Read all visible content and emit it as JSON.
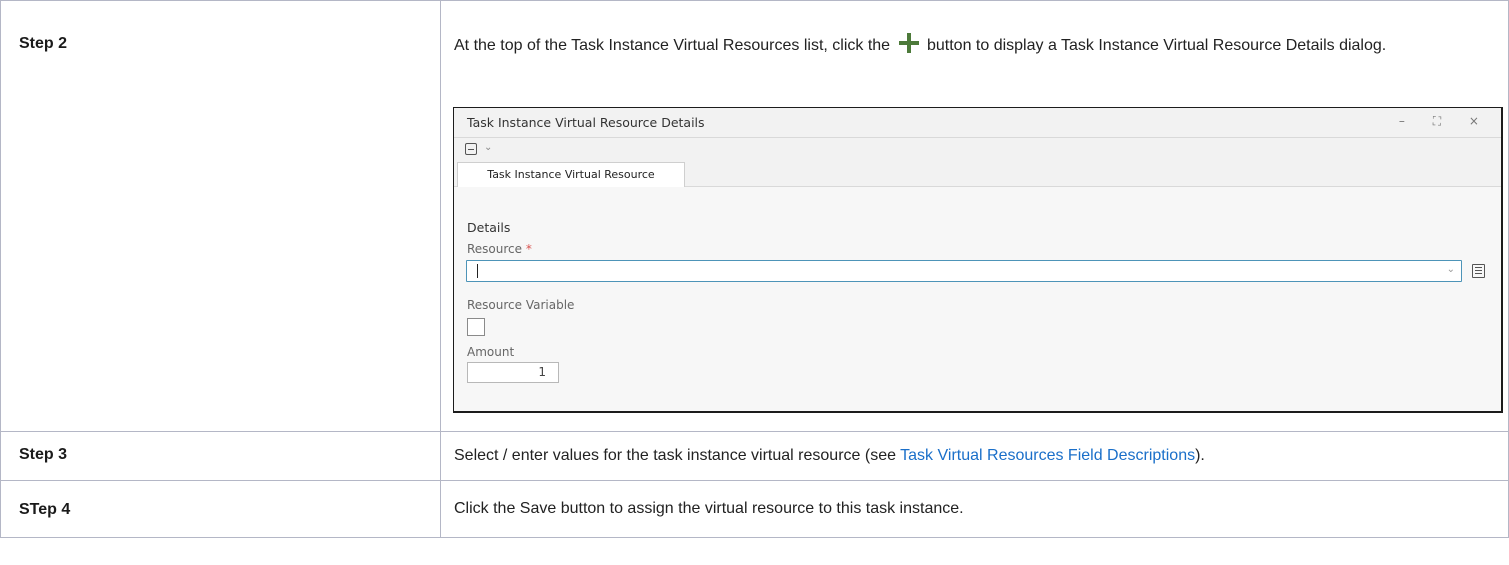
{
  "steps": [
    {
      "label": "Step 2",
      "text_before": "At the top of the Task Instance Virtual Resources list, click the",
      "text_after": "button to display a Task Instance Virtual Resource Details dialog."
    },
    {
      "label": "Step 3",
      "text_before": "Select / enter values for the task instance virtual resource (see ",
      "link": "Task Virtual Resources Field Descriptions",
      "text_after": ")."
    },
    {
      "label": "STep 4",
      "text": "Click the Save button to assign the virtual resource to this task instance."
    }
  ],
  "dialog": {
    "title": "Task Instance Virtual Resource Details",
    "window_controls": "– ⛶ ×",
    "tab": "Task Instance Virtual Resource",
    "section": "Details",
    "resource_label": "Resource",
    "required_mark": "*",
    "resource_variable_label": "Resource Variable",
    "amount_label": "Amount",
    "amount_value": "1"
  },
  "colors": {
    "link": "#1a6fc9",
    "plus_icon": "#4d7a3a",
    "input_focus_border": "#4d94b8",
    "required": "#d9534f"
  },
  "icons": [
    "plus-icon",
    "save-icon",
    "chevron-down-icon",
    "list-icon",
    "minimize-icon",
    "maximize-icon",
    "close-icon"
  ]
}
